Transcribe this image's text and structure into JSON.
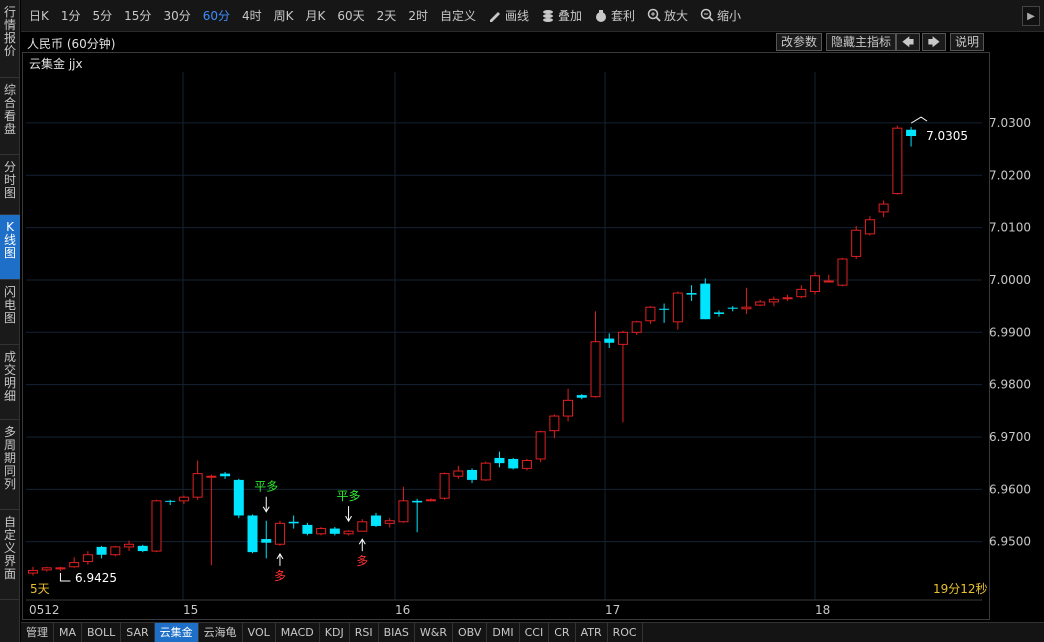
{
  "side_tabs": [
    {
      "label": "行情报价",
      "active": false
    },
    {
      "label": "综合看盘",
      "active": false
    },
    {
      "label": "分时图",
      "active": false
    },
    {
      "label": "K线图",
      "active": true
    },
    {
      "label": "闪电图",
      "active": false
    },
    {
      "label": "成交明细",
      "active": false
    },
    {
      "label": "多周期同列",
      "active": false
    },
    {
      "label": "自定义界面",
      "active": false
    }
  ],
  "toolbar": {
    "periods": [
      {
        "label": "日K",
        "active": false
      },
      {
        "label": "1分",
        "active": false
      },
      {
        "label": "5分",
        "active": false
      },
      {
        "label": "15分",
        "active": false
      },
      {
        "label": "30分",
        "active": false
      },
      {
        "label": "60分",
        "active": true
      },
      {
        "label": "4时",
        "active": false
      },
      {
        "label": "周K",
        "active": false
      },
      {
        "label": "月K",
        "active": false
      },
      {
        "label": "60天",
        "active": false
      },
      {
        "label": "2天",
        "active": false
      },
      {
        "label": "2时",
        "active": false
      },
      {
        "label": "自定义",
        "active": false
      }
    ],
    "tools": [
      {
        "label": "画线",
        "icon": "pencil-icon"
      },
      {
        "label": "叠加",
        "icon": "layers-icon"
      },
      {
        "label": "套利",
        "icon": "moneybag-icon"
      },
      {
        "label": "放大",
        "icon": "zoom-in-icon"
      },
      {
        "label": "缩小",
        "icon": "zoom-out-icon"
      }
    ],
    "expand_icon": "chevron-right-icon"
  },
  "header": {
    "instrument": "人民币 (60分钟)",
    "buttons": {
      "params": "改参数",
      "hide_indicator": "隐藏主指标",
      "help": "说明"
    },
    "arrow_left_icon": "arrow-left-icon",
    "arrow_right_icon": "arrow-right-icon"
  },
  "indicator_title": "云集金 jjx",
  "chart_data": {
    "type": "candlestick",
    "y_ticks": [
      "7.0300",
      "7.0200",
      "7.0100",
      "7.0000",
      "6.9900",
      "6.9800",
      "6.9700",
      "6.9600",
      "6.9500"
    ],
    "ylim": [
      6.94,
      7.034
    ],
    "x_labels": [
      "0512",
      "15",
      "16",
      "17",
      "18"
    ],
    "bullish_color": "#e02020",
    "bearish_color": "#00e5ff",
    "candles": [
      [
        6.944,
        6.9445,
        6.9435,
        6.9452
      ],
      [
        6.9446,
        6.945,
        6.9443,
        6.9452
      ],
      [
        6.9448,
        6.945,
        6.9444,
        6.9452
      ],
      [
        6.9452,
        6.946,
        6.945,
        6.947
      ],
      [
        6.9462,
        6.9475,
        6.9456,
        6.9482
      ],
      [
        6.949,
        6.9475,
        6.9468,
        6.9492
      ],
      [
        6.9475,
        6.949,
        6.9472,
        6.9492
      ],
      [
        6.949,
        6.9495,
        6.9482,
        6.9502
      ],
      [
        6.9492,
        6.9482,
        6.948,
        6.9494
      ],
      [
        6.9482,
        6.9578,
        6.948,
        6.958
      ],
      [
        6.9578,
        6.9577,
        6.957,
        6.958
      ],
      [
        6.9578,
        6.9585,
        6.9572,
        6.9588
      ],
      [
        6.9585,
        6.963,
        6.958,
        6.9655
      ],
      [
        6.9625,
        6.9625,
        6.9455,
        6.9628
      ],
      [
        6.963,
        6.9625,
        6.962,
        6.9633
      ],
      [
        6.9618,
        6.955,
        6.9545,
        6.962
      ],
      [
        6.955,
        6.948,
        6.9478,
        6.9552
      ],
      [
        6.9505,
        6.9498,
        6.9468,
        6.954
      ],
      [
        6.9495,
        6.9535,
        6.9492,
        6.954
      ],
      [
        6.9538,
        6.9535,
        6.9525,
        6.955
      ],
      [
        6.9532,
        6.9515,
        6.9512,
        6.9536
      ],
      [
        6.9515,
        6.9525,
        6.9512,
        6.9528
      ],
      [
        6.9525,
        6.9515,
        6.9512,
        6.9528
      ],
      [
        6.9515,
        6.952,
        6.9512,
        6.9522
      ],
      [
        6.952,
        6.9538,
        6.952,
        6.9543
      ],
      [
        6.955,
        6.953,
        6.9528,
        6.9555
      ],
      [
        6.9535,
        6.954,
        6.9527,
        6.9545
      ],
      [
        6.9538,
        6.9578,
        6.9536,
        6.9605
      ],
      [
        6.9578,
        6.9575,
        6.9518,
        6.9582
      ],
      [
        6.958,
        6.958,
        6.9578,
        6.9583
      ],
      [
        6.9583,
        6.963,
        6.958,
        6.9632
      ],
      [
        6.9625,
        6.9635,
        6.962,
        6.9645
      ],
      [
        6.9637,
        6.9618,
        6.9612,
        6.964
      ],
      [
        6.9618,
        6.965,
        6.9616,
        6.9653
      ],
      [
        6.966,
        6.965,
        6.9642,
        6.9672
      ],
      [
        6.9658,
        6.964,
        6.9638,
        6.966
      ],
      [
        6.964,
        6.9655,
        6.9636,
        6.9658
      ],
      [
        6.9658,
        6.971,
        6.9652,
        6.9712
      ],
      [
        6.9712,
        6.974,
        6.9698,
        6.9743
      ],
      [
        6.974,
        6.977,
        6.973,
        6.9792
      ],
      [
        6.978,
        6.9775,
        6.9772,
        6.9782
      ],
      [
        6.9777,
        6.9882,
        6.9775,
        6.994
      ],
      [
        6.9888,
        6.988,
        6.987,
        6.9898
      ],
      [
        6.9877,
        6.99,
        6.9728,
        6.9903
      ],
      [
        6.99,
        6.992,
        6.9895,
        6.9922
      ],
      [
        6.9922,
        6.9948,
        6.9916,
        6.995
      ],
      [
        6.9945,
        6.9943,
        6.9918,
        6.9955
      ],
      [
        6.992,
        6.9975,
        6.9905,
        6.9978
      ],
      [
        6.9975,
        6.9972,
        6.996,
        6.999
      ],
      [
        6.9993,
        6.9925,
        6.9925,
        7.0003
      ],
      [
        6.9938,
        6.9935,
        6.993,
        6.9942
      ],
      [
        6.9947,
        6.9945,
        6.994,
        6.995
      ],
      [
        6.9945,
        6.9948,
        6.9935,
        6.9985
      ],
      [
        6.9952,
        6.9958,
        6.995,
        6.9962
      ],
      [
        6.9958,
        6.9963,
        6.995,
        6.9968
      ],
      [
        6.9966,
        6.9966,
        6.996,
        6.9972
      ],
      [
        6.9968,
        6.9982,
        6.9965,
        6.999
      ],
      [
        6.9978,
        7.0008,
        6.9972,
        7.0015
      ],
      [
        6.9998,
        6.9998,
        6.9996,
        7.001
      ],
      [
        6.999,
        7.004,
        6.9988,
        7.0042
      ],
      [
        7.0045,
        7.0095,
        7.004,
        7.0103
      ],
      [
        7.0088,
        7.0115,
        7.0085,
        7.0122
      ],
      [
        7.013,
        7.0145,
        7.012,
        7.0152
      ],
      [
        7.0165,
        7.029,
        7.0163,
        7.0295
      ],
      [
        7.0287,
        7.0275,
        7.0255,
        7.0292
      ]
    ],
    "annotations": [
      {
        "type": "平多",
        "index": 17
      },
      {
        "type": "多",
        "index": 18
      },
      {
        "type": "平多",
        "index": 23
      },
      {
        "type": "多",
        "index": 24
      }
    ],
    "last_price_label": "7.0305",
    "low_price_label": "6.9425",
    "period_label": "5天",
    "timer_label": "19分12秒"
  },
  "bottom_tabs": [
    {
      "label": "管理",
      "active": false
    },
    {
      "label": "MA",
      "active": false
    },
    {
      "label": "BOLL",
      "active": false
    },
    {
      "label": "SAR",
      "active": false
    },
    {
      "label": "云集金",
      "active": true
    },
    {
      "label": "云海龟",
      "active": false
    },
    {
      "label": "VOL",
      "active": false
    },
    {
      "label": "MACD",
      "active": false
    },
    {
      "label": "KDJ",
      "active": false
    },
    {
      "label": "RSI",
      "active": false
    },
    {
      "label": "BIAS",
      "active": false
    },
    {
      "label": "W&R",
      "active": false
    },
    {
      "label": "OBV",
      "active": false
    },
    {
      "label": "DMI",
      "active": false
    },
    {
      "label": "CCI",
      "active": false
    },
    {
      "label": "CR",
      "active": false
    },
    {
      "label": "ATR",
      "active": false
    },
    {
      "label": "ROC",
      "active": false
    }
  ],
  "colors": {
    "accent": "#1e6fc8",
    "active_text": "#3d8dff",
    "grid": "#1c2a3a",
    "yellow": "#e8c030"
  }
}
